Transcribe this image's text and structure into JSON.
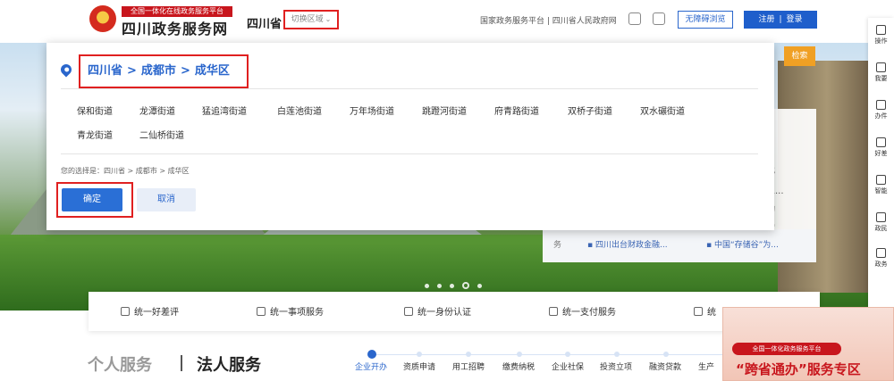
{
  "header": {
    "brand_top": "全国一体化在线政务服务平台",
    "brand_main": "四川政务服务网",
    "province": "四川省",
    "switch_region": "切换区域",
    "top_links": "国家政务服务平台 | 四川省人民政府网",
    "accessibility": "无障碍浏览",
    "register": "注册",
    "login": "登录"
  },
  "search": {
    "button": "检索"
  },
  "region_modal": {
    "breadcrumb": [
      "四川省",
      "成都市",
      "成华区"
    ],
    "separator": ">",
    "streets": [
      "保和街道",
      "龙潭街道",
      "猛追湾街道",
      "白莲池街道",
      "万年场街道",
      "跳蹬河街道",
      "府青路街道",
      "双桥子街道",
      "双水碾街道",
      "青龙街道",
      "二仙桥街道"
    ],
    "choice_label": "您的选择是：四川省 > 成都市 > 成华区",
    "confirm": "确定",
    "cancel": "取消"
  },
  "news": {
    "partial_lines": [
      "批",
      "息...",
      "询",
      "定...",
      "2..."
    ],
    "category": "务",
    "items": [
      "四川出台财政金融...",
      "中国“存储谷”为..."
    ]
  },
  "carousel": {
    "count": 5,
    "active": 4
  },
  "services": [
    "统一好差评",
    "统一事项服务",
    "统一身份认证",
    "统一支付服务",
    "统"
  ],
  "sections": {
    "personal": "个人服务",
    "legal": "法人服务"
  },
  "categories": [
    "企业开办",
    "资质申请",
    "用工招聘",
    "缴费纳税",
    "企业社保",
    "投资立项",
    "融资贷款",
    "生产"
  ],
  "active_category": 0,
  "right_float": [
    "操作",
    "我要",
    "办件",
    "好差",
    "智能",
    "政民",
    "政务"
  ],
  "promo": {
    "tag": "全国一体化政务服务平台",
    "title": "“跨省通办”服务专区"
  },
  "colors": {
    "accent": "#2a66cc",
    "alert_frame": "#e02020",
    "search": "#f0a024",
    "brand_red": "#c8161d"
  }
}
